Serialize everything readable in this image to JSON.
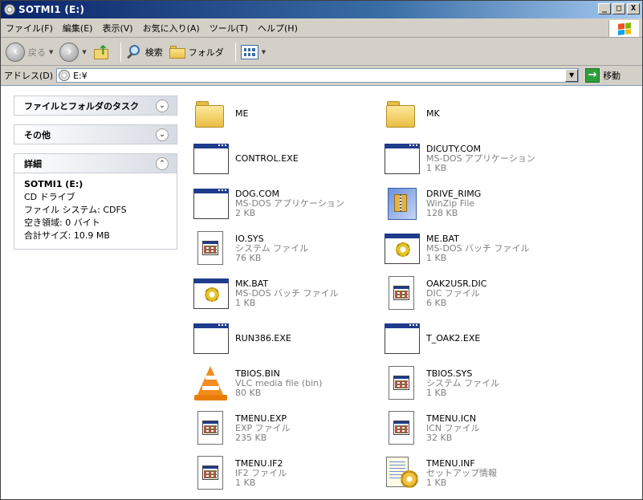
{
  "window": {
    "title": "SOTMI1 (E:)",
    "controls": {
      "minimize": "_",
      "maximize": "□",
      "close": "X"
    }
  },
  "menu": {
    "items": [
      "ファイル(F)",
      "編集(E)",
      "表示(V)",
      "お気に入り(A)",
      "ツール(T)",
      "ヘルプ(H)"
    ]
  },
  "toolbar": {
    "back": "戻る",
    "search": "検索",
    "folders": "フォルダ"
  },
  "address": {
    "label": "アドレス(D)",
    "value": "E:¥",
    "go": "移動"
  },
  "tasks": {
    "panel1": "ファイルとフォルダのタスク",
    "panel2": "その他",
    "panel3": "詳細",
    "details": {
      "name": "SOTMI1 (E:)",
      "type": "CD ドライブ",
      "fs": "ファイル システム: CDFS",
      "free": "空き領域: 0 バイト",
      "total": "合計サイズ: 10.9 MB"
    }
  },
  "files": [
    {
      "name": "ME",
      "type": "",
      "size": "",
      "icon": "folder-icon"
    },
    {
      "name": "MK",
      "type": "",
      "size": "",
      "icon": "folder-icon"
    },
    {
      "name": "CONTROL.EXE",
      "type": "",
      "size": "",
      "icon": "exe-icon"
    },
    {
      "name": "DICUTY.COM",
      "type": "MS-DOS アプリケーション",
      "size": "1 KB",
      "icon": "exe-icon"
    },
    {
      "name": "DOG.COM",
      "type": "MS-DOS アプリケーション",
      "size": "2 KB",
      "icon": "exe-icon"
    },
    {
      "name": "DRIVE_RIMG",
      "type": "WinZip File",
      "size": "128 KB",
      "icon": "winzip-icon"
    },
    {
      "name": "IO.SYS",
      "type": "システム ファイル",
      "size": "76 KB",
      "icon": "system-file-icon"
    },
    {
      "name": "ME.BAT",
      "type": "MS-DOS バッチ ファイル",
      "size": "1 KB",
      "icon": "batch-file-icon"
    },
    {
      "name": "MK.BAT",
      "type": "MS-DOS バッチ ファイル",
      "size": "1 KB",
      "icon": "batch-file-icon"
    },
    {
      "name": "OAK2USR.DIC",
      "type": "DIC ファイル",
      "size": "6 KB",
      "icon": "system-file-icon"
    },
    {
      "name": "RUN386.EXE",
      "type": "",
      "size": "",
      "icon": "exe-icon"
    },
    {
      "name": "T_OAK2.EXE",
      "type": "",
      "size": "",
      "icon": "exe-icon"
    },
    {
      "name": "TBIOS.BIN",
      "type": "VLC media file (bin)",
      "size": "80 KB",
      "icon": "vlc-icon"
    },
    {
      "name": "TBIOS.SYS",
      "type": "システム ファイル",
      "size": "1 KB",
      "icon": "system-file-icon"
    },
    {
      "name": "TMENU.EXP",
      "type": "EXP ファイル",
      "size": "235 KB",
      "icon": "system-file-icon"
    },
    {
      "name": "TMENU.ICN",
      "type": "ICN ファイル",
      "size": "32 KB",
      "icon": "system-file-icon"
    },
    {
      "name": "TMENU.IF2",
      "type": "IF2 ファイル",
      "size": "1 KB",
      "icon": "system-file-icon"
    },
    {
      "name": "TMENU.INF",
      "type": "セットアップ情報",
      "size": "1 KB",
      "icon": "setup-info-icon"
    }
  ]
}
